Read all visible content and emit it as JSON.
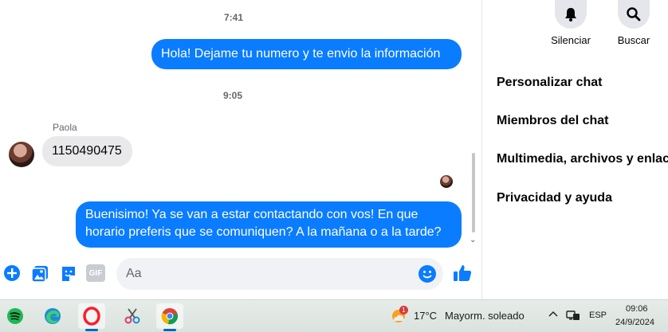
{
  "chat": {
    "time1": "7:41",
    "msg1": "Hola! Dejame tu numero y te envio la información",
    "time2": "9:05",
    "sender": "Paola",
    "msg2": "1150490475",
    "msg3_line1": "Buenisimo! Ya se van a estar contactando con vos! En que",
    "msg3_line2": "horario preferis que se comuniquen? A la mañana o a la tarde?"
  },
  "composer": {
    "placeholder": "Aa",
    "gif_label": "GIF"
  },
  "panel": {
    "mute_label": "Silenciar",
    "search_label": "Buscar",
    "items": [
      "Personalizar chat",
      "Miembros del chat",
      "Multimedia, archivos y enlaces",
      "Privacidad y ayuda"
    ]
  },
  "taskbar": {
    "weather_temp": "17°C",
    "weather_desc": "Mayorm. soleado",
    "weather_badge": "1",
    "language": "ESP",
    "clock_time": "09:06",
    "clock_date": "24/9/2024"
  },
  "colors": {
    "accent": "#0a7cff",
    "incoming_bubble": "#e9e9eb"
  }
}
